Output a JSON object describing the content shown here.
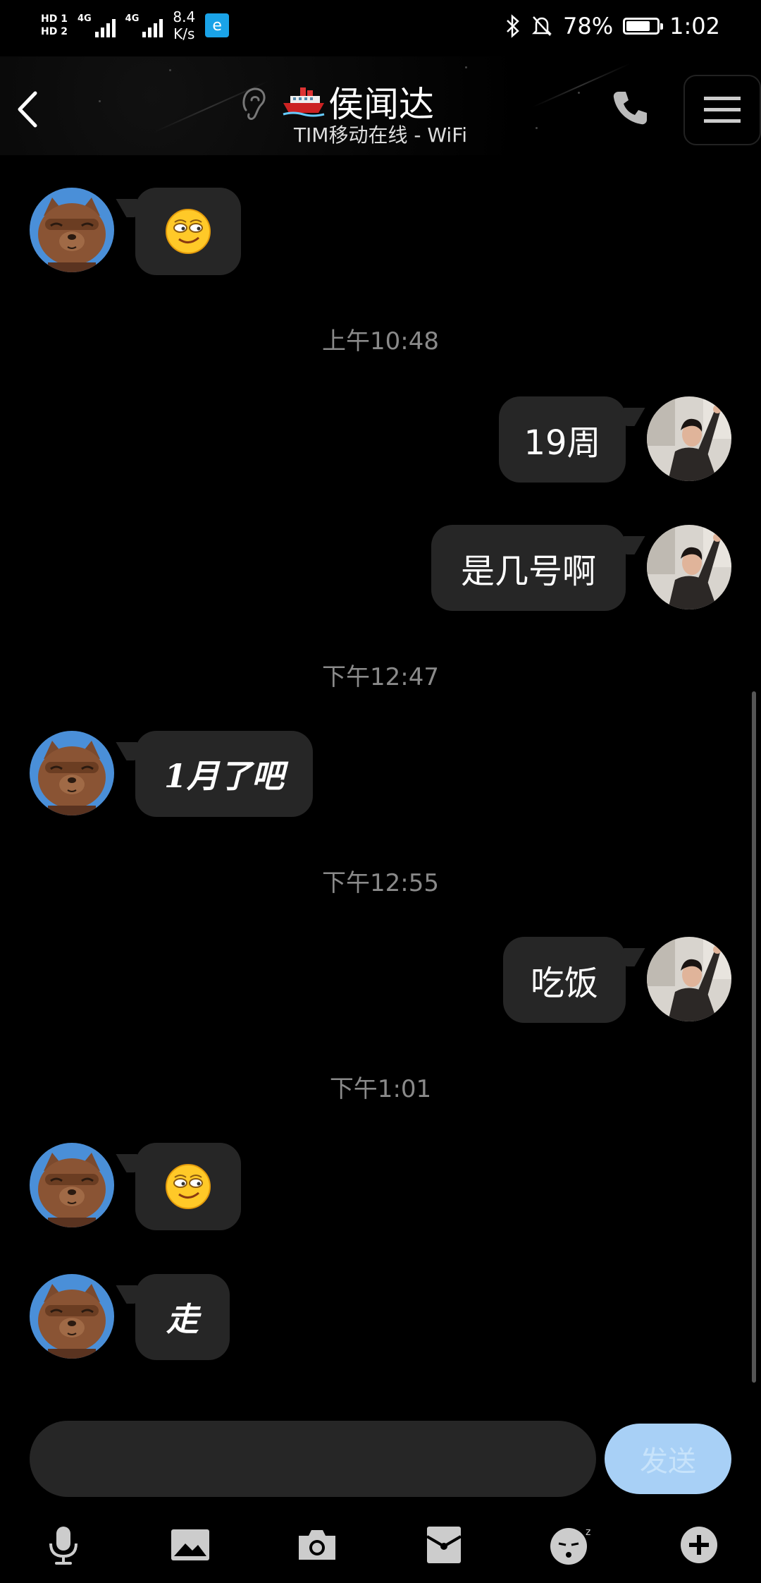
{
  "status_bar": {
    "hd1": "HD 1",
    "hd2": "HD 2",
    "signal1_label": "4G",
    "signal2_label": "4G",
    "speed_value": "8.4",
    "speed_unit": "K/s",
    "battery_percent": "78%",
    "battery_level": 0.78,
    "time": "1:02"
  },
  "header": {
    "title": "侯闻达",
    "subtitle": "TIM移动在线 - WiFi"
  },
  "messages": [
    {
      "type": "emoji",
      "side": "left",
      "emoji": "smug-face"
    },
    {
      "type": "time",
      "text": "上午10:48"
    },
    {
      "type": "text",
      "side": "right",
      "text": "19周"
    },
    {
      "type": "text",
      "side": "right",
      "text": "是几号啊"
    },
    {
      "type": "time",
      "text": "下午12:47"
    },
    {
      "type": "text",
      "side": "left",
      "text": "1月了吧"
    },
    {
      "type": "time",
      "text": "下午12:55"
    },
    {
      "type": "text",
      "side": "right",
      "text": "吃饭"
    },
    {
      "type": "time",
      "text": "下午1:01"
    },
    {
      "type": "emoji",
      "side": "left",
      "emoji": "smug-face"
    },
    {
      "type": "text",
      "side": "left",
      "text": "走"
    }
  ],
  "input": {
    "value": "",
    "send_label": "发送"
  },
  "toolbar": [
    "microphone-icon",
    "image-icon",
    "camera-icon",
    "red-packet-icon",
    "emoticon-icon",
    "plus-icon"
  ],
  "colors": {
    "background": "#000000",
    "bubble": "#262626",
    "send_button": "#a8d0f6",
    "timestamp": "#8a8a8a"
  }
}
